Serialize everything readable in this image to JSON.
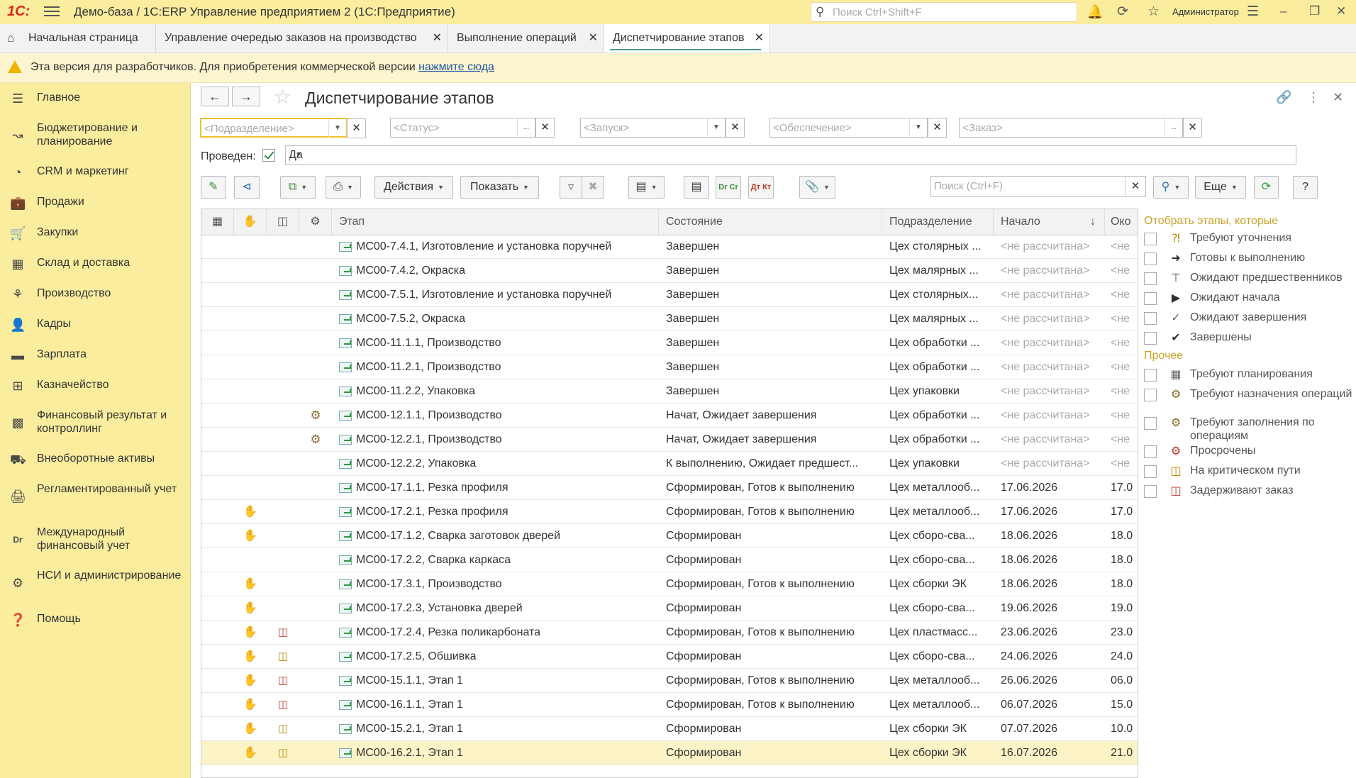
{
  "app": {
    "logo": "1С:",
    "title": "Демо-база / 1С:ERP Управление предприятием 2  (1С:Предприятие)",
    "search_placeholder": "Поиск Ctrl+Shift+F",
    "user": "Администратор"
  },
  "tabs": [
    {
      "label": "Начальная страница"
    },
    {
      "label": "Управление очередью заказов на производство"
    },
    {
      "label": "Выполнение операций"
    },
    {
      "label": "Диспетчирование этапов"
    }
  ],
  "notice": {
    "text": "Эта версия для разработчиков. Для приобретения коммерческой версии ",
    "link": "нажмите сюда"
  },
  "sidebar": {
    "items": [
      {
        "label": "Главное",
        "icon": "menu-icon"
      },
      {
        "label": "Бюджетирование и планирование",
        "icon": "budget-icon"
      },
      {
        "label": "CRM и маркетинг",
        "icon": "crm-icon"
      },
      {
        "label": "Продажи",
        "icon": "sales-icon"
      },
      {
        "label": "Закупки",
        "icon": "cart-icon"
      },
      {
        "label": "Склад и доставка",
        "icon": "warehouse-icon"
      },
      {
        "label": "Производство",
        "icon": "factory-icon"
      },
      {
        "label": "Кадры",
        "icon": "person-icon"
      },
      {
        "label": "Зарплата",
        "icon": "salary-icon"
      },
      {
        "label": "Казначейство",
        "icon": "treasury-icon"
      },
      {
        "label": "Финансовый результат и контроллинг",
        "icon": "chart-icon"
      },
      {
        "label": "Внеоборотные активы",
        "icon": "assets-icon"
      },
      {
        "label": "Регламентированный учет",
        "icon": "accounting-icon"
      },
      {
        "label": "Международный финансовый учет",
        "icon": "dr-cr-icon"
      },
      {
        "label": "НСИ и администрирование",
        "icon": "gear-icon"
      },
      {
        "label": "Помощь",
        "icon": "help-icon"
      }
    ]
  },
  "page": {
    "title": "Диспетчирование этапов",
    "filters": {
      "division": "<Подразделение>",
      "status": "<Статус>",
      "launch": "<Запуск>",
      "supply": "<Обеспечение>",
      "order": "<Заказ>"
    },
    "posted_label": "Проведен:",
    "posted_value": "Да"
  },
  "toolbar": {
    "actions": "Действия",
    "show": "Показать",
    "search_placeholder": "Поиск (Ctrl+F)",
    "more": "Еще",
    "help": "?",
    "dr_cr": "Dr Cr",
    "dt_kt": "Дт Кт"
  },
  "grid": {
    "columns": [
      "Этап",
      "Состояние",
      "Подразделение",
      "Начало",
      "Око"
    ],
    "rows": [
      {
        "c1": "",
        "c2": "",
        "c3": "",
        "stage": "МС00-7.4.1, Изготовление и установка поручней",
        "state": "Завершен",
        "div": "Цех столярных ...",
        "start": "<не рассчитана>",
        "end": "<не",
        "muted": true
      },
      {
        "c1": "",
        "c2": "",
        "c3": "",
        "stage": "МС00-7.4.2, Окраска",
        "state": "Завершен",
        "div": "Цех малярных ...",
        "start": "<не рассчитана>",
        "end": "<не",
        "muted": true
      },
      {
        "c1": "",
        "c2": "",
        "c3": "",
        "stage": "МС00-7.5.1, Изготовление и установка поручней",
        "state": "Завершен",
        "div": "Цех столярных...",
        "start": "<не рассчитана>",
        "end": "<не",
        "muted": true
      },
      {
        "c1": "",
        "c2": "",
        "c3": "",
        "stage": "МС00-7.5.2, Окраска",
        "state": "Завершен",
        "div": "Цех малярных ...",
        "start": "<не рассчитана>",
        "end": "<не",
        "muted": true
      },
      {
        "c1": "",
        "c2": "",
        "c3": "",
        "stage": "МС00-11.1.1, Производство",
        "state": "Завершен",
        "div": "Цех обработки ...",
        "start": "<не рассчитана>",
        "end": "<не",
        "muted": true
      },
      {
        "c1": "",
        "c2": "",
        "c3": "",
        "stage": "МС00-11.2.1, Производство",
        "state": "Завершен",
        "div": "Цех обработки ...",
        "start": "<не рассчитана>",
        "end": "<не",
        "muted": true
      },
      {
        "c1": "",
        "c2": "",
        "c3": "",
        "stage": "МС00-11.2.2, Упаковка",
        "state": "Завершен",
        "div": "Цех упаковки",
        "start": "<не рассчитана>",
        "end": "<не",
        "muted": true
      },
      {
        "c1": "",
        "c2": "",
        "c3": "gear",
        "stage": "МС00-12.1.1, Производство",
        "state": "Начат, Ожидает завершения",
        "div": "Цех обработки ...",
        "start": "<не рассчитана>",
        "end": "<не",
        "muted": true
      },
      {
        "c1": "",
        "c2": "",
        "c3": "gear",
        "stage": "МС00-12.2.1, Производство",
        "state": "Начат, Ожидает завершения",
        "div": "Цех обработки ...",
        "start": "<не рассчитана>",
        "end": "<не",
        "muted": true
      },
      {
        "c1": "",
        "c2": "",
        "c3": "",
        "stage": "МС00-12.2.2, Упаковка",
        "state": "К выполнению, Ожидает предшест...",
        "div": "Цех упаковки",
        "start": "<не рассчитана>",
        "end": "<не",
        "muted": true
      },
      {
        "c1": "",
        "c2": "",
        "c3": "",
        "stage": "МС00-17.1.1, Резка профиля",
        "state": "Сформирован, Готов к выполнению",
        "div": "Цех металлооб...",
        "start": "17.06.2026",
        "end": "17.0",
        "muted": false
      },
      {
        "c1": "",
        "c2": "hand",
        "c3": "",
        "stage": "МС00-17.2.1, Резка профиля",
        "state": "Сформирован, Готов к выполнению",
        "div": "Цех металлооб...",
        "start": "17.06.2026",
        "end": "17.0",
        "muted": false
      },
      {
        "c1": "",
        "c2": "hand",
        "c3": "",
        "stage": "МС00-17.1.2, Сварка заготовок дверей",
        "state": "Сформирован",
        "div": "Цех сборо-сва...",
        "start": "18.06.2026",
        "end": "18.0",
        "muted": false
      },
      {
        "c1": "",
        "c2": "",
        "c3": "",
        "stage": "МС00-17.2.2, Сварка каркаса",
        "state": "Сформирован",
        "div": "Цех сборо-сва...",
        "start": "18.06.2026",
        "end": "18.0",
        "muted": false
      },
      {
        "c1": "",
        "c2": "hand",
        "c3": "",
        "stage": "МС00-17.3.1, Производство",
        "state": "Сформирован, Готов к выполнению",
        "div": "Цех сборки ЭК",
        "start": "18.06.2026",
        "end": "18.0",
        "muted": false
      },
      {
        "c1": "",
        "c2": "hand",
        "c3": "",
        "stage": "МС00-17.2.3, Установка дверей",
        "state": "Сформирован",
        "div": "Цех сборо-сва...",
        "start": "19.06.2026",
        "end": "19.0",
        "muted": false
      },
      {
        "c1": "",
        "c2": "hand",
        "c3": "docr",
        "stage": "МС00-17.2.4, Резка поликарбоната",
        "state": "Сформирован, Готов к выполнению",
        "div": "Цех пластмасс...",
        "start": "23.06.2026",
        "end": "23.0",
        "muted": false
      },
      {
        "c1": "",
        "c2": "hand",
        "c3": "doc",
        "stage": "МС00-17.2.5, Обшивка",
        "state": "Сформирован",
        "div": "Цех сборо-сва...",
        "start": "24.06.2026",
        "end": "24.0",
        "muted": false
      },
      {
        "c1": "",
        "c2": "hand",
        "c3": "docr",
        "stage": "МС00-15.1.1, Этап 1",
        "state": "Сформирован, Готов к выполнению",
        "div": "Цех металлооб...",
        "start": "26.06.2026",
        "end": "06.0",
        "muted": false
      },
      {
        "c1": "",
        "c2": "hand",
        "c3": "docr",
        "stage": "МС00-16.1.1, Этап 1",
        "state": "Сформирован, Готов к выполнению",
        "div": "Цех металлооб...",
        "start": "06.07.2026",
        "end": "15.0",
        "muted": false
      },
      {
        "c1": "",
        "c2": "hand",
        "c3": "doc",
        "stage": "МС00-15.2.1, Этап 1",
        "state": "Сформирован",
        "div": "Цех сборки ЭК",
        "start": "07.07.2026",
        "end": "10.0",
        "muted": false
      },
      {
        "c1": "",
        "c2": "hand",
        "c3": "doc",
        "stage": "МС00-16.2.1, Этап 1",
        "state": "Сформирован",
        "div": "Цех сборки ЭК",
        "start": "16.07.2026",
        "end": "21.0",
        "muted": false
      }
    ]
  },
  "right_panel": {
    "title": "Отобрать этапы, которые",
    "items": [
      {
        "label": "Требуют уточнения",
        "icon": "question-icon"
      },
      {
        "label": "Готовы к выполнению",
        "icon": "arrow-right-icon"
      },
      {
        "label": "Ожидают предшественников",
        "icon": "link-icon"
      },
      {
        "label": "Ожидают начала",
        "icon": "play-icon"
      },
      {
        "label": "Ожидают завершения",
        "icon": "check-outline-icon"
      },
      {
        "label": "Завершены",
        "icon": "check-icon"
      }
    ],
    "other_title": "Прочее",
    "other_items": [
      {
        "label": "Требуют планирования",
        "icon": "calendar-icon"
      },
      {
        "label": "Требуют назначения операций",
        "icon": "gear-assign-icon"
      },
      {
        "label": "Требуют заполнения по операциям",
        "icon": "gear-fill-icon"
      },
      {
        "label": "Просрочены",
        "icon": "overdue-icon"
      },
      {
        "label": "На критическом пути",
        "icon": "critical-path-icon"
      },
      {
        "label": "Задерживают заказ",
        "icon": "delay-order-icon"
      }
    ]
  }
}
